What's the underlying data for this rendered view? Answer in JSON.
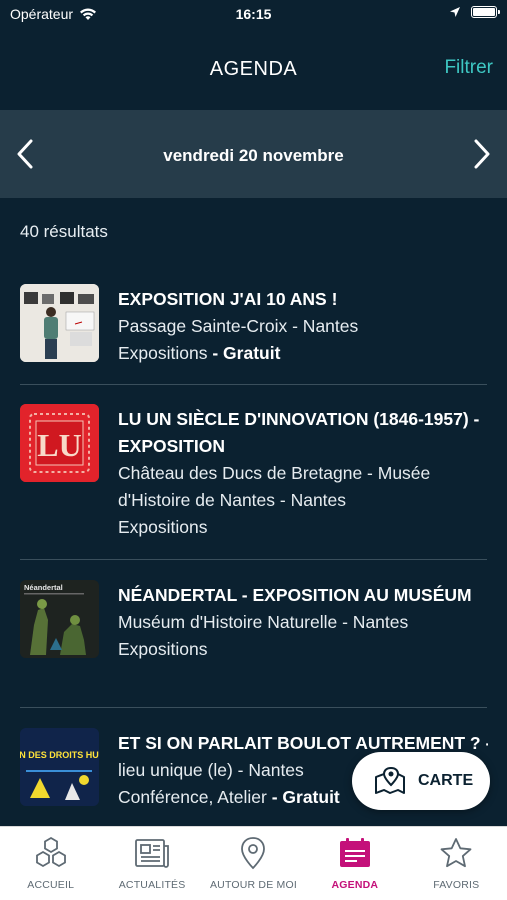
{
  "status_bar": {
    "carrier": "Opérateur",
    "time": "16:15"
  },
  "header": {
    "title": "AGENDA",
    "filter_label": "Filtrer"
  },
  "date_bar": {
    "date": "vendredi 20 novembre"
  },
  "results_count": "40 résultats",
  "events": [
    {
      "title": "EXPOSITION J'AI 10 ANS !",
      "location": "Passage Sainte-Croix - Nantes",
      "category": "Expositions",
      "price": " - Gratuit",
      "thumb": "exhibition-photo"
    },
    {
      "title": "LU UN SIÈCLE D'INNOVATION (1846-1957) - EXPOSITION",
      "location": "Château des Ducs de Bretagne - Musée d'Histoire de Nantes - Nantes",
      "category": "Expositions",
      "price": "",
      "thumb": "lu-logo",
      "thumb_text": "LU"
    },
    {
      "title": "NÉANDERTAL - EXPOSITION AU MUSÉUM",
      "location": "Muséum d'Histoire Naturelle - Nantes",
      "category": "Expositions",
      "price": "",
      "thumb": "neandertal-poster",
      "thumb_text": "Néandertal"
    },
    {
      "title": "ET SI ON PARLAIT BOULOT AUTREMENT ? - SAISON DES DROITS HU",
      "location": "lieu unique (le) - Nantes",
      "category": "Conférence, Atelier",
      "price": " - Gratuit",
      "thumb": "saison-droits-humains-poster",
      "thumb_text": "SAISON DES DROITS HUMAINS"
    }
  ],
  "map_button": {
    "label": "CARTE",
    "icon": "map-pin-icon"
  },
  "tab_bar": {
    "tabs": [
      {
        "label": "ACCUEIL",
        "icon": "hexagons-icon",
        "active": false
      },
      {
        "label": "ACTUALITÉS",
        "icon": "newspaper-icon",
        "active": false
      },
      {
        "label": "AUTOUR DE MOI",
        "icon": "location-pin-icon",
        "active": false
      },
      {
        "label": "AGENDA",
        "icon": "calendar-icon",
        "active": true
      },
      {
        "label": "FAVORIS",
        "icon": "star-icon",
        "active": false
      }
    ]
  },
  "colors": {
    "background": "#0b2130",
    "date_bar": "#263c4a",
    "accent_teal": "#3ec7c3",
    "accent_pink": "#c4117a"
  }
}
